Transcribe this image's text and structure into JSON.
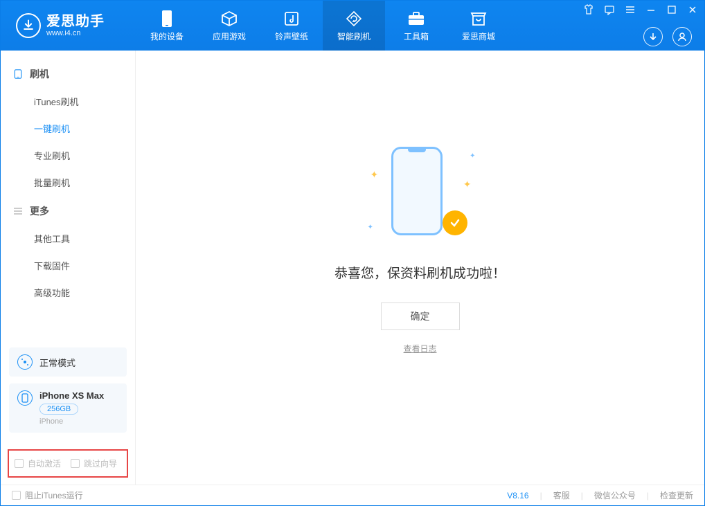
{
  "app": {
    "title": "爱思助手",
    "subtitle": "www.i4.cn"
  },
  "nav": {
    "tabs": [
      {
        "label": "我的设备",
        "icon": "device"
      },
      {
        "label": "应用游戏",
        "icon": "cube"
      },
      {
        "label": "铃声壁纸",
        "icon": "music"
      },
      {
        "label": "智能刷机",
        "icon": "refresh",
        "active": true
      },
      {
        "label": "工具箱",
        "icon": "toolbox"
      },
      {
        "label": "爱思商城",
        "icon": "store"
      }
    ]
  },
  "sidebar": {
    "flash": {
      "heading": "刷机",
      "items": [
        "iTunes刷机",
        "一键刷机",
        "专业刷机",
        "批量刷机"
      ],
      "active_index": 1
    },
    "more": {
      "heading": "更多",
      "items": [
        "其他工具",
        "下载固件",
        "高级功能"
      ]
    }
  },
  "device_mode": {
    "label": "正常模式"
  },
  "device_info": {
    "name": "iPhone XS Max",
    "capacity": "256GB",
    "type": "iPhone"
  },
  "options": {
    "auto_activate": "自动激活",
    "skip_wizard": "跳过向导"
  },
  "main": {
    "success_message": "恭喜您，保资料刷机成功啦！",
    "ok_button": "确定",
    "view_log": "查看日志"
  },
  "footer": {
    "block_itunes": "阻止iTunes运行",
    "version": "V8.16",
    "links": [
      "客服",
      "微信公众号",
      "检查更新"
    ]
  }
}
